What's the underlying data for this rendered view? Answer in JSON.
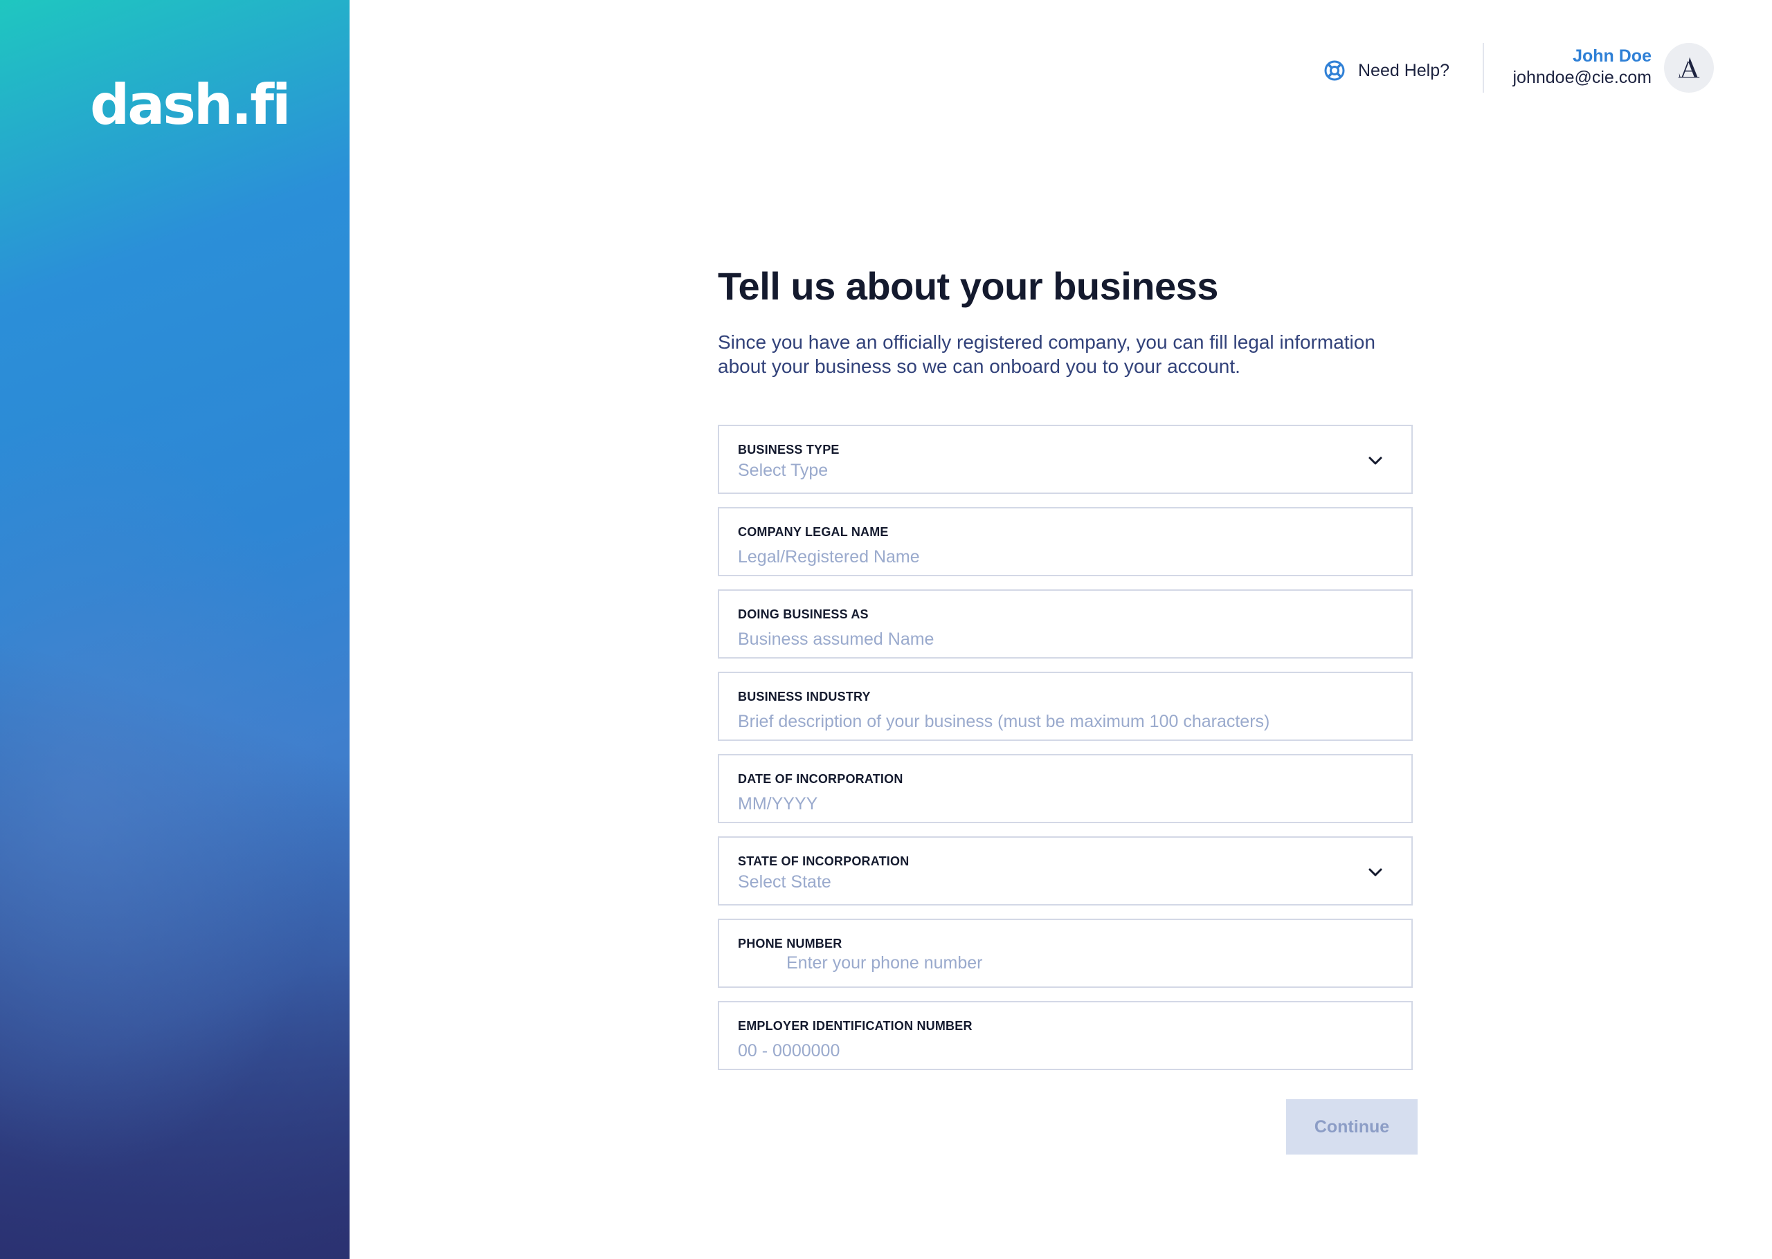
{
  "brand": {
    "logo_text": "dash.fi"
  },
  "header": {
    "help_label": "Need Help?",
    "user_name": "John Doe",
    "user_email": "johndoe@cie.com",
    "help_icon": "lifebuoy-icon",
    "avatar_icon": "company-logo-icon"
  },
  "main": {
    "title": "Tell us about your business",
    "subtitle": "Since you have an officially registered company, you can fill legal information about your business so we can onboard you to your account.",
    "fields": [
      {
        "label": "BUSINESS TYPE",
        "placeholder": "Select Type",
        "kind": "select"
      },
      {
        "label": "COMPANY LEGAL NAME",
        "placeholder": "Legal/Registered Name",
        "kind": "text"
      },
      {
        "label": "DOING BUSINESS AS",
        "placeholder": "Business assumed Name",
        "kind": "text"
      },
      {
        "label": "BUSINESS INDUSTRY",
        "placeholder": "Brief description of your business (must be maximum 100 characters)",
        "kind": "text"
      },
      {
        "label": "DATE OF INCORPORATION",
        "placeholder": "MM/YYYY",
        "kind": "text"
      },
      {
        "label": "STATE OF INCORPORATION",
        "placeholder": "Select State",
        "kind": "select"
      },
      {
        "label": "PHONE NUMBER",
        "placeholder": "Enter your phone number",
        "kind": "tel"
      },
      {
        "label": "EMPLOYER IDENTIFICATION NUMBER",
        "placeholder": "00 - 0000000",
        "kind": "text"
      }
    ],
    "continue_label": "Continue"
  },
  "colors": {
    "accent": "#2f80d6",
    "text_dark": "#141a2e",
    "placeholder": "#9aaacd",
    "field_border": "#d3d8e6",
    "button_disabled_bg": "#d6deef",
    "button_disabled_text": "#8c9dc6"
  }
}
